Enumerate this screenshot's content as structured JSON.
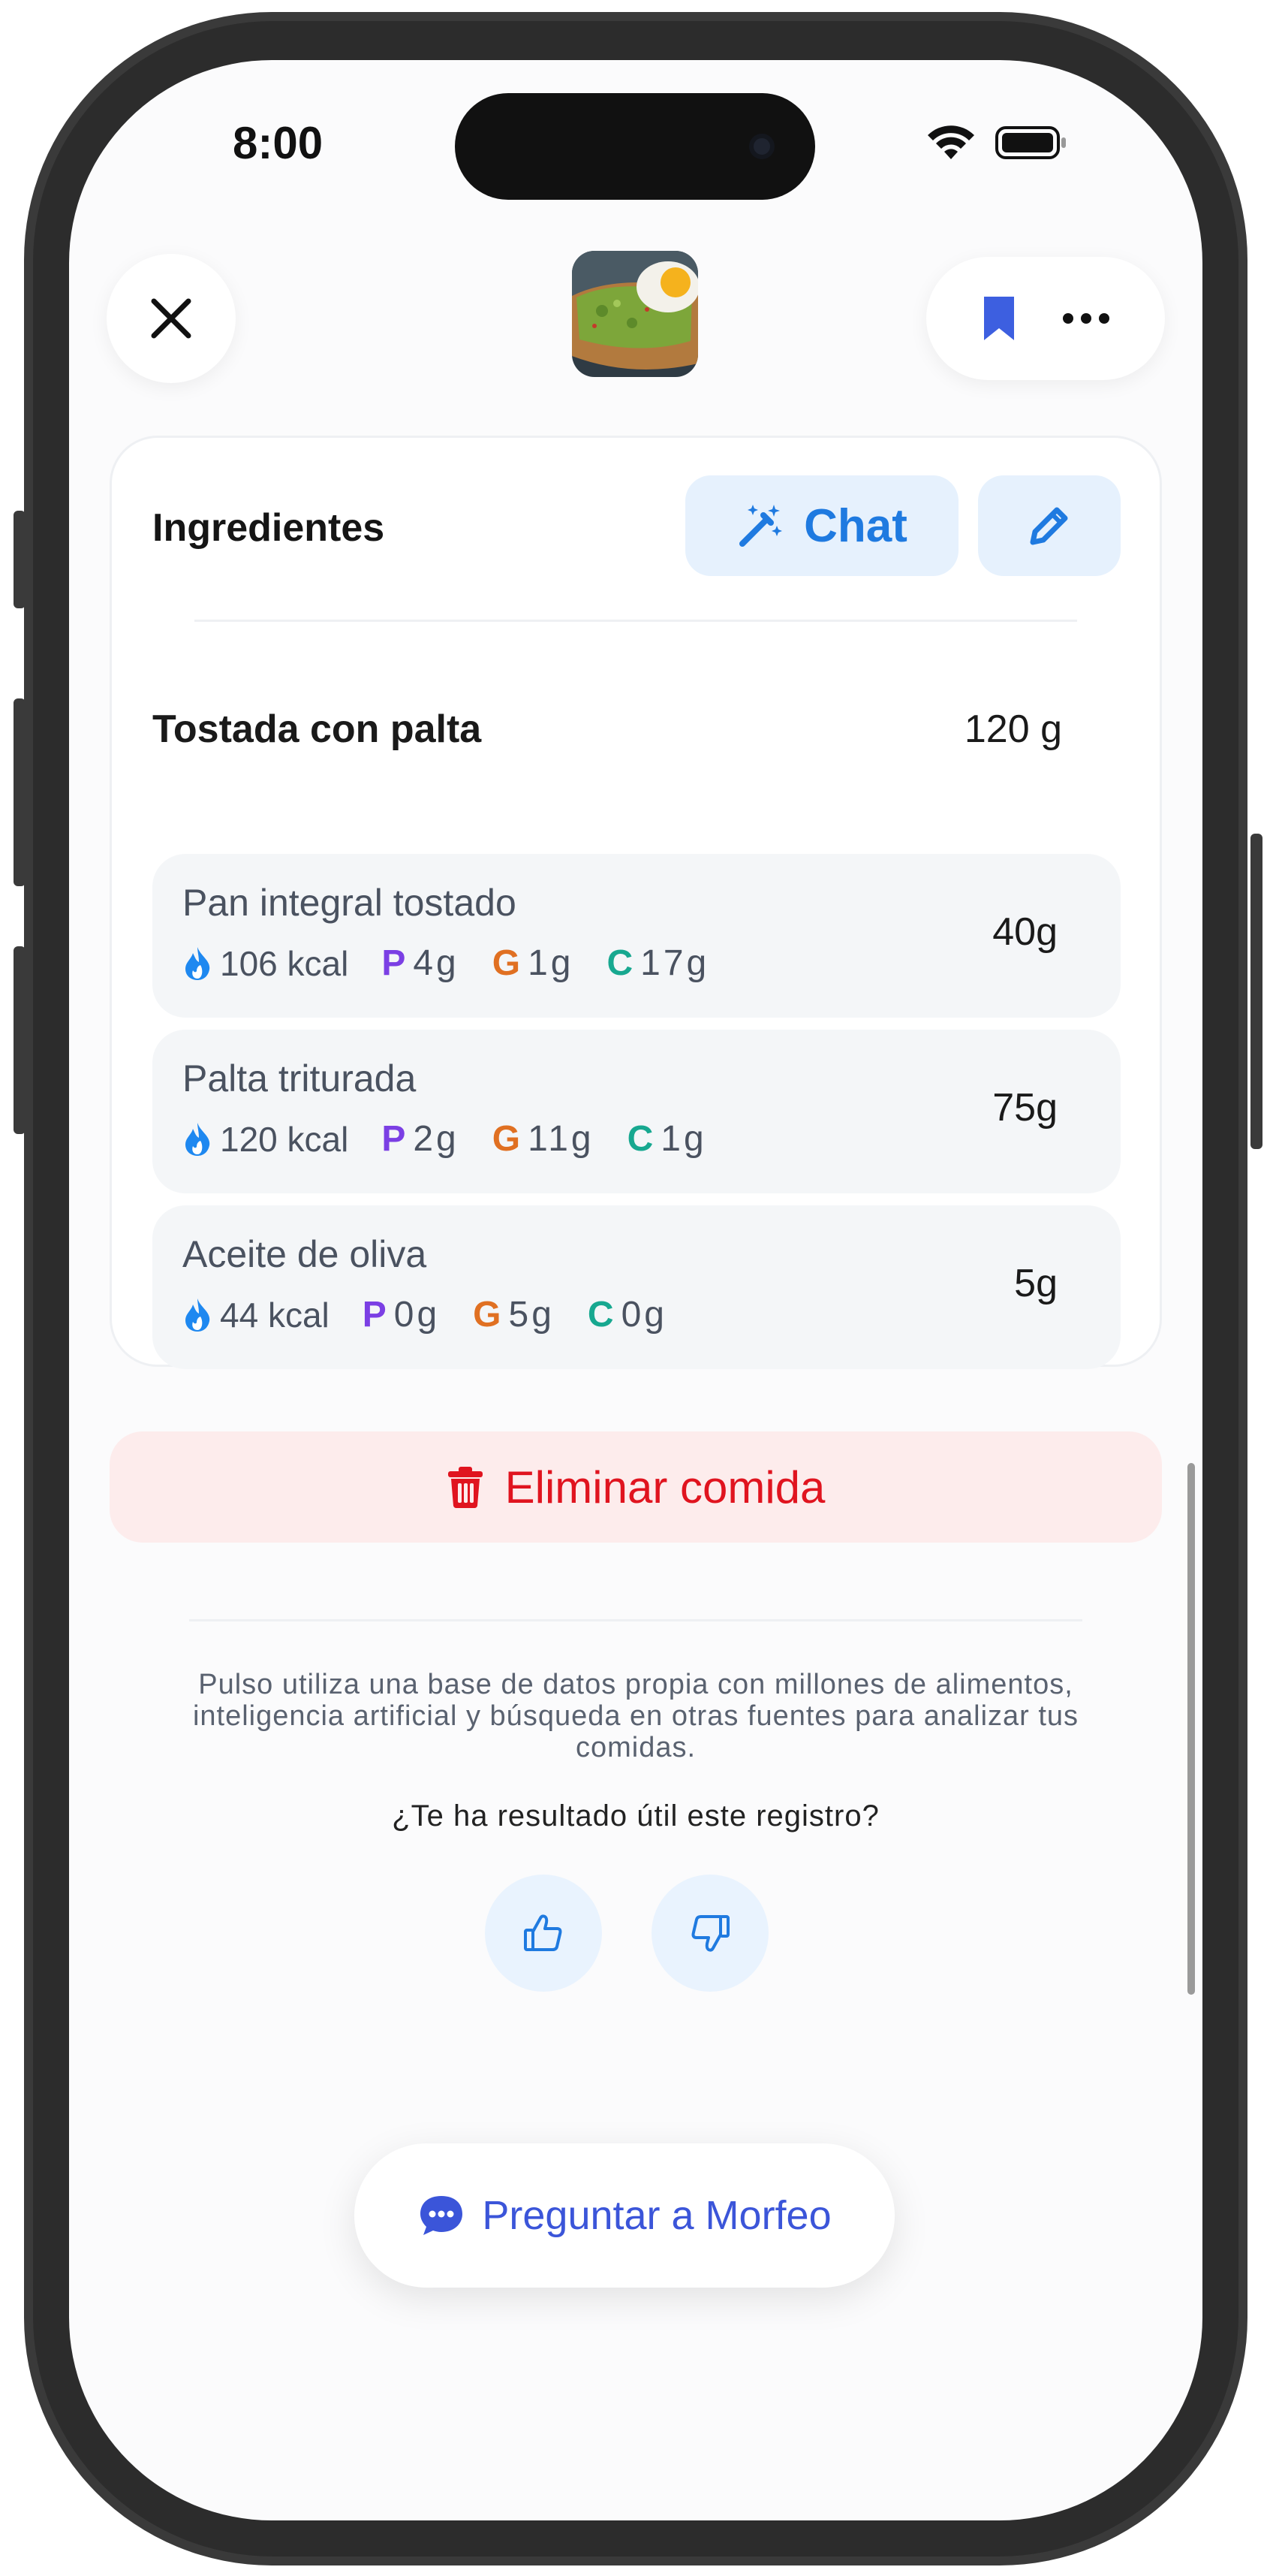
{
  "status_bar": {
    "time": "8:00"
  },
  "header": {
    "close_icon": "close-icon",
    "bookmark_icon": "bookmark-icon",
    "more_icon": "more-icon",
    "thumbnail": "avocado-toast-photo"
  },
  "ingredients_card": {
    "title": "Ingredientes",
    "chat_button": "Chat",
    "edit_icon": "pencil-icon",
    "group": {
      "name": "Tostada con palta",
      "weight": "120 g"
    },
    "items": [
      {
        "name": "Pan integral tostado",
        "weight": "40g",
        "kcal": "106 kcal",
        "p": "4g",
        "g": "1g",
        "c": "17g"
      },
      {
        "name": "Palta triturada",
        "weight": "75g",
        "kcal": "120 kcal",
        "p": "2g",
        "g": "11g",
        "c": "1g"
      },
      {
        "name": "Aceite de oliva",
        "weight": "5g",
        "kcal": "44 kcal",
        "p": "0g",
        "g": "5g",
        "c": "0g"
      }
    ],
    "macro_letters": {
      "p": "P",
      "g": "G",
      "c": "C"
    }
  },
  "delete_button": "Eliminar comida",
  "disclaimer": "Pulso utiliza una base de datos propia con millones de alimentos, inteligencia artificial y búsqueda en otras fuentes para analizar tus comidas.",
  "feedback": {
    "question": "¿Te ha resultado útil este registro?"
  },
  "ask_button": "Preguntar a Morfeo",
  "colors": {
    "accent": "#1f7ae0",
    "danger": "#e0141f",
    "protein": "#7b3fe4",
    "fat": "#e07022",
    "carbs": "#17a890",
    "ask": "#3b55d9"
  }
}
